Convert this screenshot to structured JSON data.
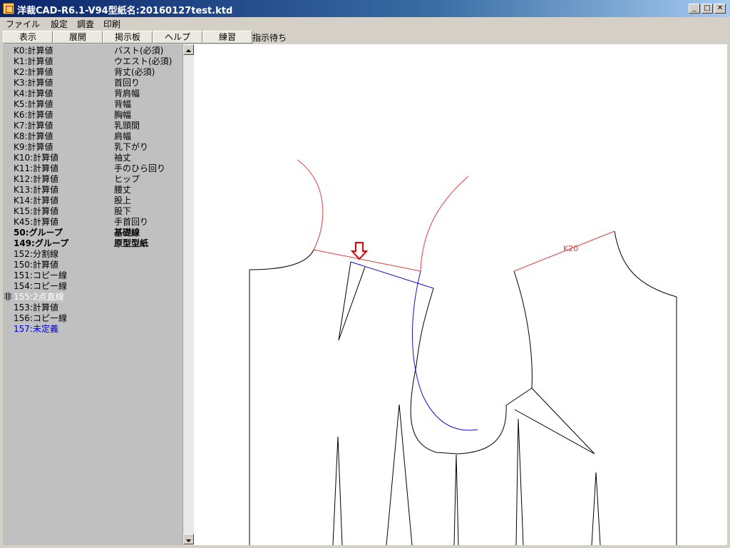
{
  "window": {
    "title": "洋裁CAD-R6.1-V94型紙名:20160127test.ktd",
    "minimize": "_",
    "maximize": "□",
    "close": "✕"
  },
  "menu": [
    "ファイル",
    "設定",
    "調査",
    "印刷"
  ],
  "toolbar": {
    "buttons": [
      "表示",
      "展開",
      "掲示板",
      "ヘルプ",
      "練習"
    ],
    "status": "指示待ち"
  },
  "list": [
    {
      "flag": "",
      "code": "K0:計算値",
      "label": "バスト(必須)",
      "style": ""
    },
    {
      "flag": "",
      "code": "K1:計算値",
      "label": "ウエスト(必須)",
      "style": ""
    },
    {
      "flag": "",
      "code": "K2:計算値",
      "label": "背丈(必須)",
      "style": ""
    },
    {
      "flag": "",
      "code": "K3:計算値",
      "label": "首回り",
      "style": ""
    },
    {
      "flag": "",
      "code": "K4:計算値",
      "label": "背肩幅",
      "style": ""
    },
    {
      "flag": "",
      "code": "K5:計算値",
      "label": "背幅",
      "style": ""
    },
    {
      "flag": "",
      "code": "K6:計算値",
      "label": "胸幅",
      "style": ""
    },
    {
      "flag": "",
      "code": "K7:計算値",
      "label": "乳頭間",
      "style": ""
    },
    {
      "flag": "",
      "code": "K8:計算値",
      "label": "肩幅",
      "style": ""
    },
    {
      "flag": "",
      "code": "K9:計算値",
      "label": "乳下がり",
      "style": ""
    },
    {
      "flag": "",
      "code": "K10:計算値",
      "label": "袖丈",
      "style": ""
    },
    {
      "flag": "",
      "code": "K11:計算値",
      "label": "手のひら回り",
      "style": ""
    },
    {
      "flag": "",
      "code": "K12:計算値",
      "label": "ヒップ",
      "style": ""
    },
    {
      "flag": "",
      "code": "K13:計算値",
      "label": "腰丈",
      "style": ""
    },
    {
      "flag": "",
      "code": "K14:計算値",
      "label": "股上",
      "style": ""
    },
    {
      "flag": "",
      "code": "K15:計算値",
      "label": "股下",
      "style": ""
    },
    {
      "flag": "",
      "code": "K45:計算値",
      "label": "手首回り",
      "style": ""
    },
    {
      "flag": "",
      "code": "50:グループ",
      "label": "基礎線",
      "style": "bold"
    },
    {
      "flag": "",
      "code": "149:グループ",
      "label": "原型型紙",
      "style": "bold"
    },
    {
      "flag": "",
      "code": "152:分割線",
      "label": "",
      "style": ""
    },
    {
      "flag": "",
      "code": "150:計算値",
      "label": "",
      "style": ""
    },
    {
      "flag": "",
      "code": "151:コピー線",
      "label": "",
      "style": ""
    },
    {
      "flag": "",
      "code": "154:コピー線",
      "label": "",
      "style": ""
    },
    {
      "flag": "非",
      "code": "155:2点直線",
      "label": "",
      "style": "disabled"
    },
    {
      "flag": "",
      "code": "153:計算値",
      "label": "",
      "style": ""
    },
    {
      "flag": "",
      "code": "156:コピー線",
      "label": "",
      "style": ""
    },
    {
      "flag": "",
      "code": "157:未定義",
      "label": "",
      "style": "blue"
    }
  ],
  "canvas": {
    "label_k20": "K20",
    "colors": {
      "outline": "#000000",
      "red": "#e04040",
      "blue": "#1010d0",
      "marker": "#e00000"
    }
  }
}
